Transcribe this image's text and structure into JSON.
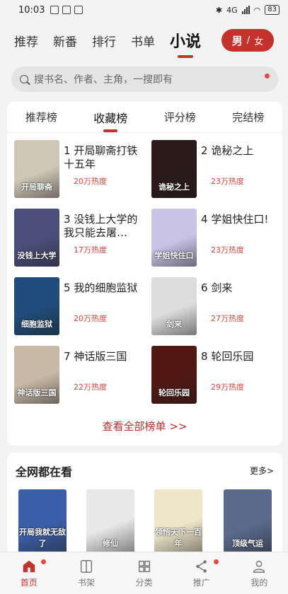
{
  "status": {
    "time": "10:03",
    "battery": "83",
    "net": "4G"
  },
  "nav": {
    "tabs": [
      "推荐",
      "新番",
      "排行",
      "书单",
      "小说"
    ],
    "gender_male": "男",
    "sep": "/",
    "gender_female": "女"
  },
  "search": {
    "placeholder": "搜书名、作者、主角，一搜即有"
  },
  "ranking": {
    "tabs": [
      "推荐榜",
      "收藏榜",
      "评分榜",
      "完结榜"
    ],
    "books": [
      {
        "rank": "1",
        "title": "开局聊斋打铁十五年",
        "heat": "20万热度",
        "cover_text": "开局聊斋",
        "color": "#cfc7b6"
      },
      {
        "rank": "2",
        "title": "诡秘之上",
        "heat": "23万热度",
        "cover_text": "诡秘之上",
        "color": "#2a1a1a"
      },
      {
        "rank": "3",
        "title": "没钱上大学的我只能去屠…",
        "heat": "17万热度",
        "cover_text": "没钱上大学",
        "color": "#4a4f7a"
      },
      {
        "rank": "4",
        "title": "学姐快住口!",
        "heat": "23万热度",
        "cover_text": "学姐快住口",
        "color": "#c9c3e6"
      },
      {
        "rank": "5",
        "title": "我的细胞监狱",
        "heat": "20万热度",
        "cover_text": "细胞监狱",
        "color": "#1f4c7a"
      },
      {
        "rank": "6",
        "title": "剑来",
        "heat": "27万热度",
        "cover_text": "剑来",
        "color": "#dddddd"
      },
      {
        "rank": "7",
        "title": "神话版三国",
        "heat": "22万热度",
        "cover_text": "神话版三国",
        "color": "#c8b9a6"
      },
      {
        "rank": "8",
        "title": "轮回乐园",
        "heat": "29万热度",
        "cover_text": "轮回乐园",
        "color": "#521812"
      }
    ],
    "view_all": "查看全部榜单 >>"
  },
  "recommend": {
    "title": "全网都在看",
    "more": "更多>",
    "covers": [
      {
        "text": "开局我就无敌了",
        "color": "#3b5fa8"
      },
      {
        "text": "修仙",
        "color": "#e8e8e8"
      },
      {
        "text": "领悟天下一百年",
        "color": "#efe6c9"
      },
      {
        "text": "顶级气运",
        "color": "#5a6b8c"
      }
    ]
  },
  "bottom_nav": [
    "首页",
    "书架",
    "分类",
    "推广",
    "我的"
  ]
}
